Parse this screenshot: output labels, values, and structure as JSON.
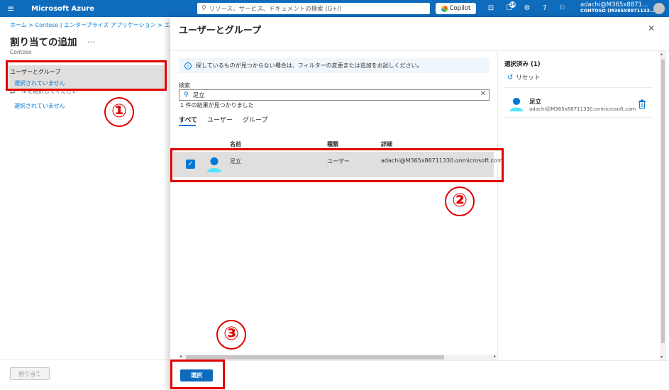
{
  "topbar": {
    "brand": "Microsoft Azure",
    "search_placeholder": "リソース、サービス、ドキュメントの検索 (G+/)",
    "copilot_label": "Copilot",
    "notification_count": "10",
    "account_user": "adachi@M365x8871…",
    "account_tenant": "CONTOSO (M365X8871133…"
  },
  "blade": {
    "breadcrumb": "ホーム > Contoso | エンタープライズ アプリケーション > エンター",
    "title": "割り当ての追加",
    "more": "…",
    "subtitle": "Contoso",
    "section_users_label": "ユーザーとグループ",
    "section_users_value": "選択されていません",
    "section_role_label": "ロールを選択してください *",
    "section_role_value": "選択されていません",
    "assign_button": "割り当て"
  },
  "panel": {
    "title": "ユーザーとグループ",
    "close": "✕",
    "info_text": "探しているものが見つからない場合は、フィルターの変更または追加をお試しください。",
    "search_label": "検索",
    "search_value": "足立",
    "result_count": "1 件の結果が見つかりました",
    "tabs": [
      "すべて",
      "ユーザー",
      "グループ"
    ],
    "columns": {
      "name": "名前",
      "type": "種類",
      "details": "詳細"
    },
    "row": {
      "name": "足立",
      "type": "ユーザー",
      "details": "adachi@M365x88711330.onmicrosoft.com"
    },
    "selected_title": "選択済み (1)",
    "reset": "リセット",
    "selected_item": {
      "name": "足立",
      "email": "adachi@M365x88711330.onmicrosoft.com"
    },
    "select_button": "選択"
  },
  "annotations": {
    "step1": "①",
    "step2": "②",
    "step3": "③",
    "highlight_color": "#e00000"
  },
  "colors": {
    "azure_blue": "#0f6cbd",
    "link_blue": "#0078d4"
  }
}
